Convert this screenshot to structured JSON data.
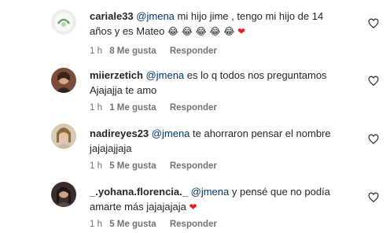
{
  "comments": [
    {
      "user": "cariale33",
      "mention": "@jmena",
      "line1": " mi hijo jime , tengo mi hijo de 14",
      "line2": "años y es Mateo ",
      "emojis": "😂 😂 😂 😂 😂",
      "heart": "❤",
      "time": "1 h",
      "likes": "8 Me gusta",
      "reply": "Responder"
    },
    {
      "user": "miierzetich",
      "mention": "@jmena",
      "line1": " es lo q todos nos preguntamos",
      "line2": "Ajajajja te amo",
      "time": "1 h",
      "likes": "1 Me gusta",
      "reply": "Responder"
    },
    {
      "user": "nadireyes23",
      "mention": "@jmena",
      "line1": " te ahorraron pensar el nombre",
      "line2": "jajajajjaja",
      "time": "1 h",
      "likes": "5 Me gusta",
      "reply": "Responder"
    },
    {
      "user": "_.yohana.florencia._",
      "mention": "@jmena",
      "line1": " y pensé que no podía",
      "line2": "amarte más jajajajaja ",
      "heart": "❤",
      "time": "1 h",
      "likes": "5 Me gusta",
      "reply": "Responder"
    }
  ],
  "colors": {
    "username": "#262626",
    "mention": "#00376b",
    "meta": "#737373",
    "heart": "#ed1c24"
  },
  "icons": {
    "like": "heart-outline-icon"
  }
}
